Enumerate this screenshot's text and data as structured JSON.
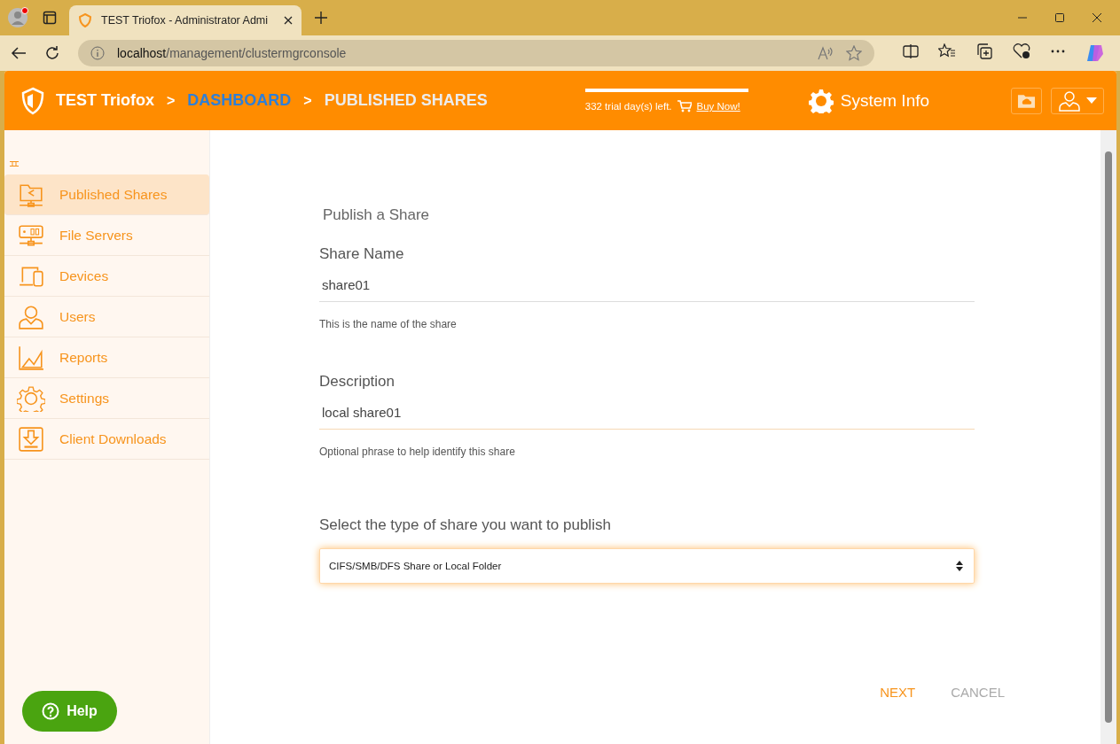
{
  "browser": {
    "tab_title": "TEST Triofox - Administrator Admi",
    "address_host": "localhost",
    "address_path": "/management/clustermgrconsole"
  },
  "header": {
    "brand": "TEST Triofox",
    "breadcrumb": [
      {
        "separator": ">",
        "label": "DASHBOARD",
        "kind": "link"
      },
      {
        "separator": ">",
        "label": "PUBLISHED SHARES",
        "kind": "current"
      }
    ],
    "trial_text": "332 trial day(s) left.",
    "buy_link": "Buy Now!",
    "system_info": "System Info"
  },
  "sidebar": {
    "items": [
      {
        "label": "Published Shares",
        "selected": true
      },
      {
        "label": "File Servers",
        "selected": false
      },
      {
        "label": "Devices",
        "selected": false
      },
      {
        "label": "Users",
        "selected": false
      },
      {
        "label": "Reports",
        "selected": false
      },
      {
        "label": "Settings",
        "selected": false
      },
      {
        "label": "Client Downloads",
        "selected": false
      }
    ]
  },
  "form": {
    "title": "Publish a Share",
    "fields": [
      {
        "label": "Share Name",
        "value": "share01",
        "hint": "This is the name of the share"
      },
      {
        "label": "Description",
        "value": "local share01",
        "hint": "Optional phrase to help identify this share"
      }
    ],
    "select_label": "Select the type of share you want to publish",
    "select_value": "CIFS/SMB/DFS Share or Local Folder",
    "buttons": [
      {
        "label": "NEXT",
        "kind": "primary"
      },
      {
        "label": "CANCEL",
        "kind": "secondary"
      }
    ]
  },
  "help_button": "Help"
}
